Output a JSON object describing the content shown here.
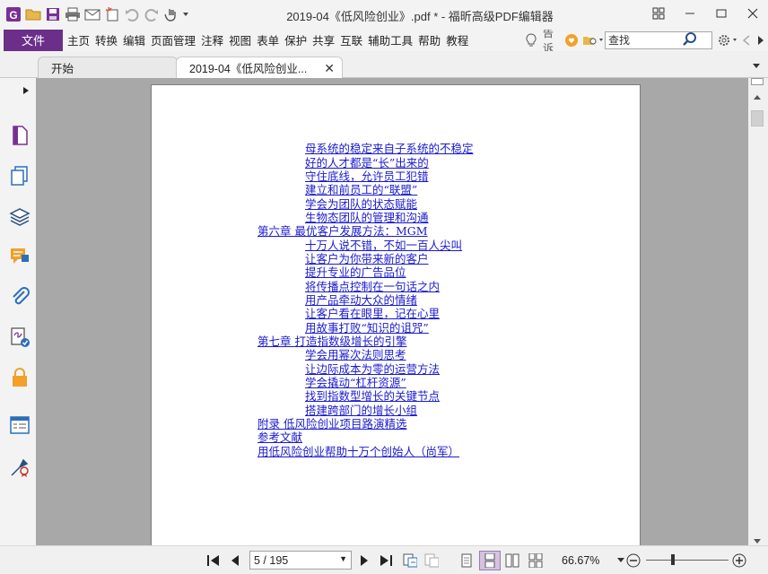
{
  "window": {
    "title": "2019-04《低风险创业》.pdf * - 福昕高级PDF编辑器"
  },
  "menubar": {
    "file_label": "文件",
    "items": [
      "主页",
      "转换",
      "编辑",
      "页面管理",
      "注释",
      "视图",
      "表单",
      "保护",
      "共享",
      "互联",
      "辅助工具",
      "帮助",
      "教程"
    ],
    "tell_me": "告诉",
    "search_placeholder": "查找"
  },
  "tabs": [
    {
      "label": "开始"
    },
    {
      "label": "2019-04《低风险创业..."
    }
  ],
  "toc": [
    {
      "text": "母系统的稳定来自子系统的不稳定",
      "level": 2
    },
    {
      "text": "好的人才都是“长”出来的",
      "level": 2
    },
    {
      "text": "守住底线，允许员工犯错",
      "level": 2
    },
    {
      "text": "建立和前员工的“联盟”",
      "level": 2
    },
    {
      "text": "学会为团队的状态赋能",
      "level": 2
    },
    {
      "text": "生物态团队的管理和沟通",
      "level": 2
    },
    {
      "text": "第六章  最优客户发展方法：MGM",
      "level": 1
    },
    {
      "text": "十万人说不错，不如一百人尖叫",
      "level": 2
    },
    {
      "text": "让客户为你带来新的客户",
      "level": 2
    },
    {
      "text": "提升专业的广告品位",
      "level": 2
    },
    {
      "text": "将传播点控制在一句话之内",
      "level": 2
    },
    {
      "text": "用产品牵动大众的情绪",
      "level": 2
    },
    {
      "text": "让客户看在眼里，记在心里",
      "level": 2
    },
    {
      "text": "用故事打败“知识的诅咒”",
      "level": 2
    },
    {
      "text": "第七章  打造指数级增长的引擎",
      "level": 1
    },
    {
      "text": "学会用幂次法则思考",
      "level": 2
    },
    {
      "text": "让边际成本为零的运营方法",
      "level": 2
    },
    {
      "text": "学会撬动“杠杆资源”",
      "level": 2
    },
    {
      "text": "找到指数型增长的关键节点",
      "level": 2
    },
    {
      "text": "搭建跨部门的增长小组",
      "level": 2
    },
    {
      "text": "附录  低风险创业项目路演精选",
      "level": 1
    },
    {
      "text": "参考文献",
      "level": 1
    },
    {
      "text": "用低风险创业帮助十万个创始人（尚军）",
      "level": 1
    }
  ],
  "statusbar": {
    "page_display": "5 / 195",
    "zoom": "66.67%"
  },
  "colors": {
    "accent": "#6b2f8a",
    "link": "#1a1ad0",
    "view_bg": "#a8a8a8"
  }
}
